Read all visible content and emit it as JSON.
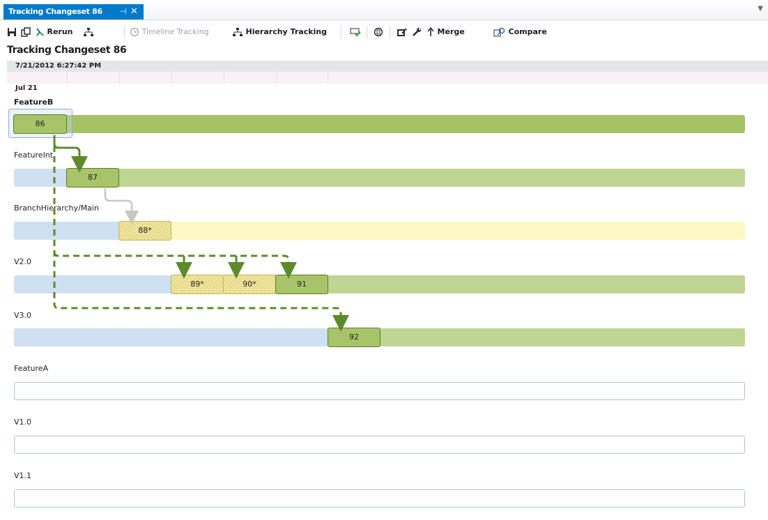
{
  "tab": {
    "title": "Tracking Changeset 86",
    "pin_glyph": "⊣",
    "close_glyph": "✕",
    "dropdown_glyph": "▼"
  },
  "toolbar": {
    "rerun_label": "Rerun",
    "timeline_label": "Timeline Tracking",
    "hierarchy_label": "Hierarchy Tracking",
    "merge_label": "Merge",
    "compare_label": "Compare"
  },
  "page_title": "Tracking Changeset 86",
  "timeline": {
    "datetime": "7/21/2012 6:27:42 PM",
    "day": "Jul 21"
  },
  "branches": [
    {
      "name": "FeatureB",
      "changesets": [
        "86"
      ]
    },
    {
      "name": "FeatureInt",
      "changesets": [
        "87"
      ]
    },
    {
      "name": "BranchHierarchy/Main",
      "changesets": [
        "88*"
      ]
    },
    {
      "name": "V2.0",
      "changesets": [
        "89*",
        "90*",
        "91"
      ]
    },
    {
      "name": "V3.0",
      "changesets": [
        "92"
      ]
    },
    {
      "name": "FeatureA",
      "changesets": []
    },
    {
      "name": "V1.0",
      "changesets": []
    },
    {
      "name": "V1.1",
      "changesets": []
    }
  ],
  "colors": {
    "accent": "#007acc",
    "merged": "#a5c264",
    "partial": "#fbf8c6",
    "arrow": "#5c8a2c"
  }
}
